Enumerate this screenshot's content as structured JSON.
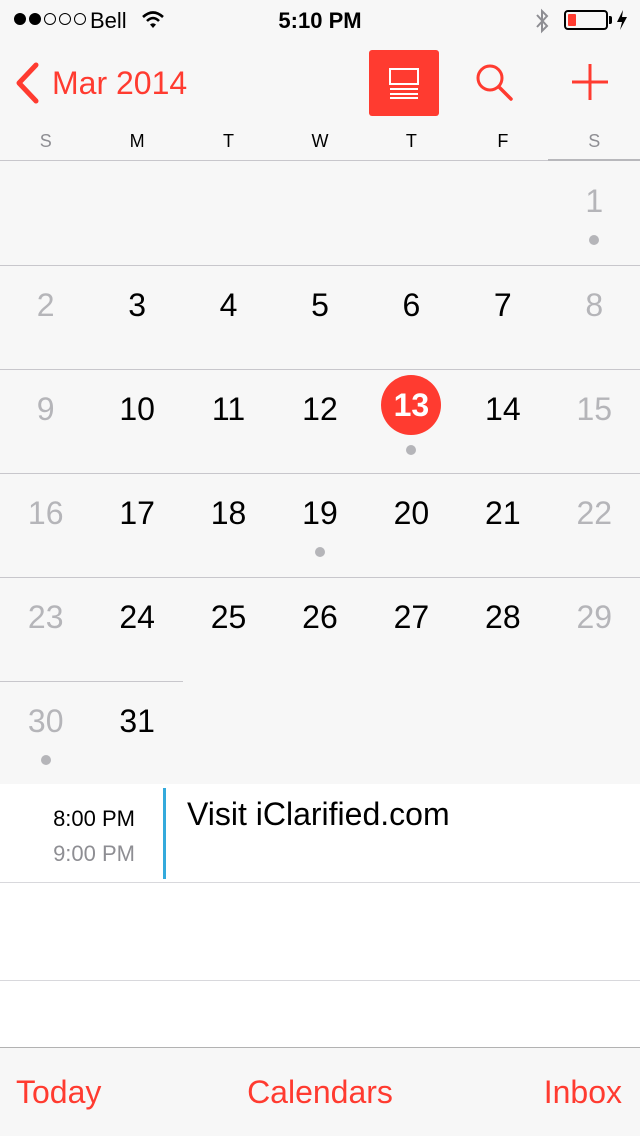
{
  "status_bar": {
    "carrier": "Bell",
    "time": "5:10 PM",
    "signal_bars_filled": 2,
    "signal_bars_total": 5,
    "battery_level": 0.15
  },
  "nav": {
    "back_label": "Mar 2014",
    "icons": [
      "chevron-left-icon",
      "list-view-icon",
      "search-icon",
      "add-icon"
    ]
  },
  "weekdays": [
    "S",
    "M",
    "T",
    "W",
    "T",
    "F",
    "S"
  ],
  "calendar": {
    "weeks": [
      [
        null,
        null,
        null,
        null,
        null,
        null,
        {
          "day": "1",
          "dot": true
        }
      ],
      [
        {
          "day": "2"
        },
        {
          "day": "3"
        },
        {
          "day": "4"
        },
        {
          "day": "5"
        },
        {
          "day": "6"
        },
        {
          "day": "7"
        },
        {
          "day": "8"
        }
      ],
      [
        {
          "day": "9"
        },
        {
          "day": "10"
        },
        {
          "day": "11"
        },
        {
          "day": "12"
        },
        {
          "day": "13",
          "today": true,
          "dot": true
        },
        {
          "day": "14"
        },
        {
          "day": "15"
        }
      ],
      [
        {
          "day": "16"
        },
        {
          "day": "17"
        },
        {
          "day": "18"
        },
        {
          "day": "19",
          "dot": true
        },
        {
          "day": "20"
        },
        {
          "day": "21"
        },
        {
          "day": "22"
        }
      ],
      [
        {
          "day": "23"
        },
        {
          "day": "24"
        },
        {
          "day": "25"
        },
        {
          "day": "26"
        },
        {
          "day": "27"
        },
        {
          "day": "28"
        },
        {
          "day": "29"
        }
      ],
      [
        {
          "day": "30",
          "dot": true
        },
        {
          "day": "31"
        },
        null,
        null,
        null,
        null,
        null
      ]
    ]
  },
  "events": [
    {
      "start": "8:00 PM",
      "end": "9:00 PM",
      "title": "Visit iClarified.com"
    }
  ],
  "tabbar": {
    "today": "Today",
    "calendars": "Calendars",
    "inbox": "Inbox"
  },
  "colors": {
    "accent": "#ff3b30",
    "event": "#34aadc",
    "weekend": "#b5b5b9"
  }
}
